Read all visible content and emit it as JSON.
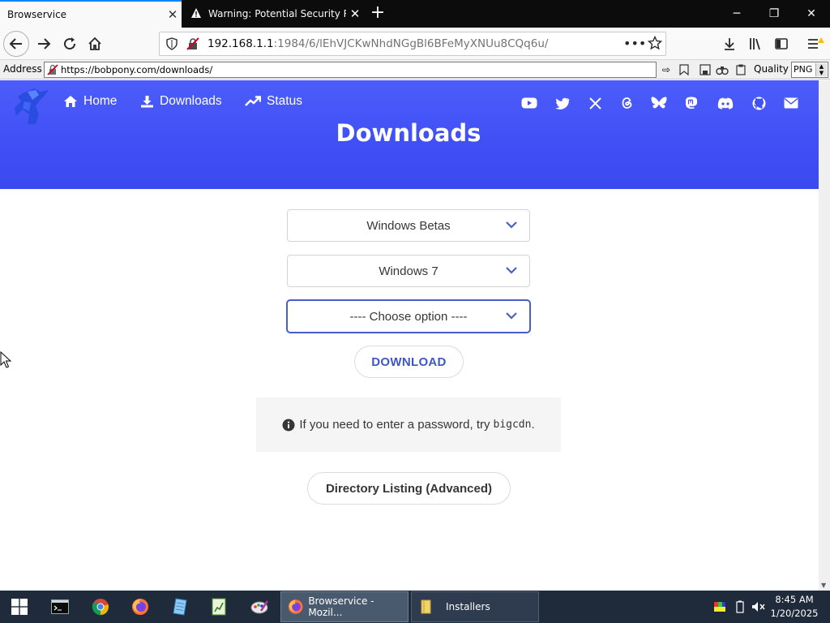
{
  "browser": {
    "tabs": [
      {
        "title": "Browservice",
        "active": true
      },
      {
        "title": "Warning: Potential Security Risk Ahead",
        "active": false
      }
    ],
    "url": {
      "host": "192.168.1.1",
      "path": ":1984/6/lEhVJCKwNhdNGgBl6BFeMyXNUu8CQq6u/"
    },
    "address_label": "Address",
    "address_value": "https://bobpony.com/downloads/",
    "quality_label": "Quality",
    "quality_value": "PNG"
  },
  "site": {
    "nav": {
      "home": "Home",
      "downloads": "Downloads",
      "status": "Status"
    },
    "social_icons": [
      "youtube-icon",
      "twitter-icon",
      "x-icon",
      "threads-icon",
      "bluesky-icon",
      "mastodon-icon",
      "discord-icon",
      "github-icon",
      "mail-icon"
    ],
    "title": "Downloads",
    "selects": [
      {
        "value": "Windows Betas"
      },
      {
        "value": "Windows 7"
      },
      {
        "value": "---- Choose option ----"
      }
    ],
    "download_button": "DOWNLOAD",
    "notice_text": "If you need to enter a password, try",
    "notice_code": "bigcdn",
    "notice_end": ".",
    "directory_button": "Directory Listing (Advanced)",
    "colors": {
      "accent": "#4050f5",
      "button_text": "#3e56c4"
    }
  },
  "taskbar": {
    "tasks": [
      {
        "label": "Browservice - Mozil...",
        "active": true
      },
      {
        "label": "Installers",
        "active": false
      }
    ],
    "time": "8:45 AM",
    "date": "1/20/2025"
  }
}
